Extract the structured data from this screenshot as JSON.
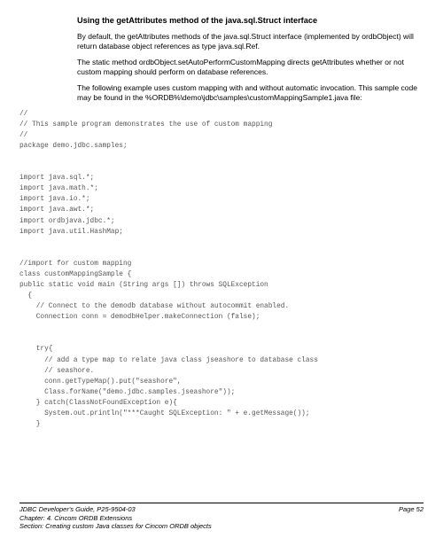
{
  "heading": "Using the getAttributes method of the java.sql.Struct interface",
  "para1": "By default, the getAttributes methods of the java.sql.Struct interface (implemented by ordbObject) will return database object references as type java.sql.Ref.",
  "para2": "The static method ordbObject.setAutoPerformCustomMapping directs getAttributes whether or not custom mapping should perform on database references.",
  "para3": "The following example uses custom mapping with and without automatic invocation.  This sample code may be found in the %ORDB%\\demo\\jdbc\\samples\\customMappingSample1.java file:",
  "code": "//\n// This sample program demonstrates the use of custom mapping\n//\npackage demo.jdbc.samples;\n\n\nimport java.sql.*;\nimport java.math.*;\nimport java.io.*;\nimport java.awt.*;\nimport ordbjava.jdbc.*;\nimport java.util.HashMap;\n\n\n//import for custom mapping\nclass customMappingSample {\npublic static void main (String args []) throws SQLException\n  {\n    // Connect to the demodb database without autocommit enabled.\n    Connection conn = demodbHelper.makeConnection (false);\n\n\n    try{\n      // add a type map to relate java class jseashore to database class\n      // seashore.\n      conn.getTypeMap().put(\"seashore\",\n      Class.forName(\"demo.jdbc.samples.jseashore\"));\n    } catch(ClassNotFoundException e){\n      System.out.println(\"***Caught SQLException: \" + e.getMessage());\n    }",
  "footer": {
    "line1_left": "JDBC Developer's Guide, P25-9504-03",
    "line1_right": "Page 52",
    "line2": "Chapter: 4. Cincom ORDB Extensions",
    "line3": "Section: Creating custom Java classes for Cincom ORDB objects"
  }
}
